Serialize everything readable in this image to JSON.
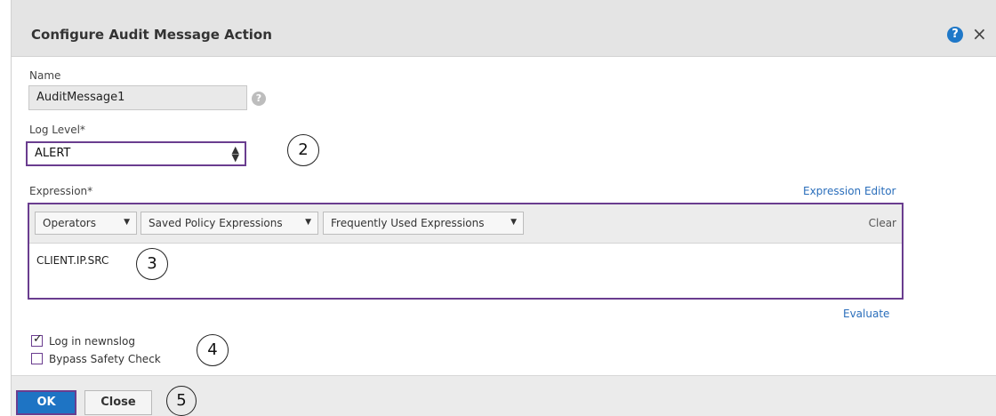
{
  "dialog": {
    "title": "Configure Audit Message Action",
    "help_icon": "?",
    "close_icon": "×"
  },
  "name": {
    "label": "Name",
    "value": "AuditMessage1",
    "help_icon": "?"
  },
  "log_level": {
    "label": "Log Level*",
    "selected": "ALERT",
    "arrows": "▲▼"
  },
  "expression": {
    "label": "Expression*",
    "editor_link": "Expression Editor",
    "toolbar": {
      "operators": "Operators",
      "saved_policy": "Saved Policy Expressions",
      "frequently_used": "Frequently Used Expressions",
      "clear": "Clear"
    },
    "value": "CLIENT.IP.SRC",
    "evaluate_link": "Evaluate"
  },
  "options": {
    "log_in_newnslog": {
      "label": "Log in newnslog",
      "checked": true
    },
    "bypass_safety_check": {
      "label": "Bypass Safety Check",
      "checked": false
    }
  },
  "footer": {
    "ok_label": "OK",
    "close_label": "Close"
  },
  "callouts": {
    "c2": "2",
    "c3": "3",
    "c4": "4",
    "c5": "5"
  },
  "colors": {
    "accent_border": "#6a3d8f",
    "primary_button": "#1e74c4",
    "link": "#2a6ebb",
    "titlebar": "#e4e4e4"
  }
}
